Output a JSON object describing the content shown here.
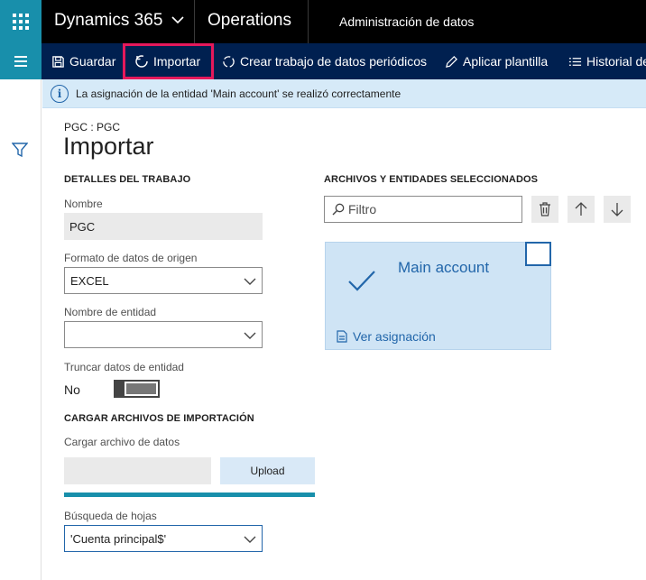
{
  "topbar": {
    "brand": "Dynamics 365",
    "module": "Operations",
    "page": "Administración de datos"
  },
  "actions": {
    "save": "Guardar",
    "import": "Importar",
    "create_job": "Crear trabajo de datos periódicos",
    "apply_template": "Aplicar plantilla",
    "history": "Historial de"
  },
  "message": "La asignación de la entidad 'Main account' se realizó correctamente",
  "breadcrumb": "PGC : PGC",
  "title": "Importar",
  "job_details": {
    "heading": "DETALLES DEL TRABAJO",
    "name_label": "Nombre",
    "name_value": "PGC",
    "format_label": "Formato de datos de origen",
    "format_value": "EXCEL",
    "entity_label": "Nombre de entidad",
    "entity_value": "",
    "truncate_label": "Truncar datos de entidad",
    "truncate_value": "No"
  },
  "upload": {
    "heading": "CARGAR ARCHIVOS DE IMPORTACIÓN",
    "file_label": "Cargar archivo de datos",
    "button": "Upload",
    "progress_fraction": 1.0,
    "sheet_label": "Búsqueda de hojas",
    "sheet_value": "'Cuenta principal$'"
  },
  "files": {
    "heading": "ARCHIVOS Y ENTIDADES SELECCIONADOS",
    "filter_placeholder": "Filtro",
    "tile_title": "Main account",
    "tile_link": "Ver asignación"
  },
  "colors": {
    "accent": "#188fab",
    "navy": "#002050",
    "highlight": "#e5195b",
    "link": "#2266aa",
    "tile_bg": "#cfe4f5"
  }
}
